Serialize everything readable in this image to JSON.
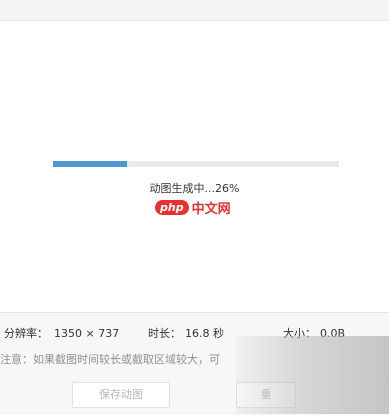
{
  "progress": {
    "fraction": 0.26,
    "status_text": "动图生成中...26%"
  },
  "watermark": {
    "badge": "php",
    "text": "中文网"
  },
  "info": {
    "resolution_label": "分辨率：",
    "resolution_value": "1350 × 737",
    "duration_label": "时长：",
    "duration_value": "16.8 秒",
    "size_label": "大小：",
    "size_value": "0.0B"
  },
  "note": "注意：如果截图时间较长或截取区域较大，可",
  "buttons": {
    "save_label": "保存动图",
    "second_label": "重"
  },
  "colors": {
    "progress_fill": "#4e96cf",
    "progress_track": "#e9e9e9",
    "watermark_red": "#e8312f"
  }
}
